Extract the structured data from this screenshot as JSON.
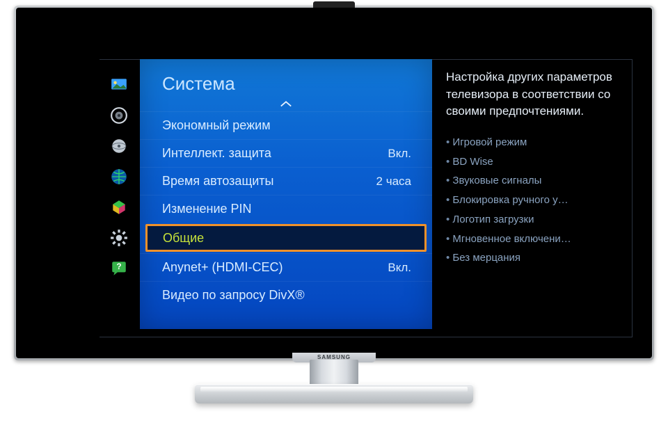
{
  "brand": "SAMSUNG",
  "sidebar": {
    "icons": [
      {
        "name": "picture-icon"
      },
      {
        "name": "sound-icon"
      },
      {
        "name": "broadcast-icon"
      },
      {
        "name": "network-icon"
      },
      {
        "name": "smarthub-icon"
      },
      {
        "name": "system-icon"
      },
      {
        "name": "support-icon"
      }
    ]
  },
  "list": {
    "title": "Система",
    "items": [
      {
        "label": "Экономный режим",
        "value": ""
      },
      {
        "label": "Интеллект. защита",
        "value": "Вкл."
      },
      {
        "label": "Время автозащиты",
        "value": "2 часа"
      },
      {
        "label": "Изменение PIN",
        "value": ""
      },
      {
        "label": "Общие",
        "value": "",
        "selected": true
      },
      {
        "label": "Anynet+ (HDMI-CEC)",
        "value": "Вкл."
      },
      {
        "label": "Видео по запросу DivX®",
        "value": ""
      }
    ]
  },
  "help": {
    "description": "Настройка других параметров телевизора в соответствии со своими предпочтениями.",
    "bullets": [
      "Игровой режим",
      "BD Wise",
      "Звуковые сигналы",
      "Блокировка ручного у…",
      "Логотип загрузки",
      "Мгновенное включени…",
      "Без мерцания"
    ]
  }
}
